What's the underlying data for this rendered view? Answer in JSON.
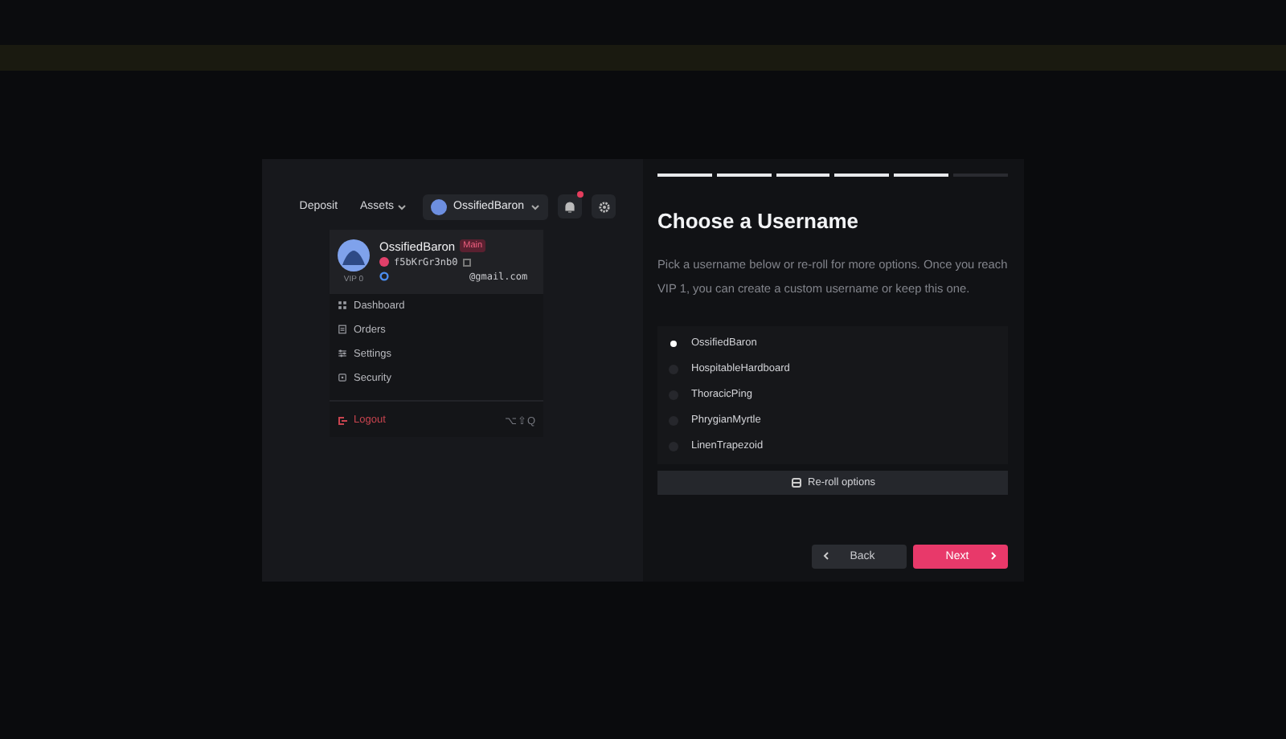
{
  "preview": {
    "nav": [
      {
        "label": "Deposit",
        "kind": "link"
      },
      {
        "label": "Assets",
        "kind": "dropdown"
      }
    ],
    "account": {
      "name": "OssifiedBaron",
      "notification": true
    },
    "profile": {
      "name": "OssifiedBaron",
      "badge": "Main",
      "uid": "f5bKrGr3nb0",
      "email": "@gmail.com",
      "vip": "VIP 0"
    },
    "menu": [
      {
        "label": "Dashboard",
        "kind": "dashboard"
      },
      {
        "label": "Orders",
        "kind": "orders"
      },
      {
        "label": "Settings",
        "kind": "settings"
      },
      {
        "label": "Security",
        "kind": "security"
      }
    ],
    "logout": {
      "label": "Logout",
      "shortcut": "⌥⇧Q"
    }
  },
  "steps": [
    {
      "done": true
    },
    {
      "done": true
    },
    {
      "done": true
    },
    {
      "done": true
    },
    {
      "done": true
    },
    {
      "done": false
    }
  ],
  "title": "Choose a Username",
  "description": "Pick a username below or re-roll for more options. Once you reach VIP 1, you can create a custom username or keep this one.",
  "usernames": [
    {
      "name": "OssifiedBaron",
      "selected": true
    },
    {
      "name": "HospitableHardboard",
      "selected": false
    },
    {
      "name": "ThoracicPing",
      "selected": false
    },
    {
      "name": "PhrygianMyrtle",
      "selected": false
    },
    {
      "name": "LinenTrapezoid",
      "selected": false
    }
  ],
  "reroll": "Re-roll options",
  "buttons": {
    "back": "Back",
    "next": "Next"
  }
}
